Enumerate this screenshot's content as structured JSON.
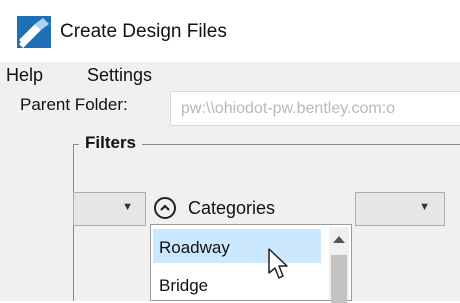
{
  "window": {
    "title": "Create Design Files",
    "icon": "bentley-app-icon"
  },
  "menu": {
    "help": "Help",
    "settings": "Settings"
  },
  "parent_folder": {
    "label": "Parent Folder:",
    "value": "pw:\\\\ohiodot-pw.bentley.com:o"
  },
  "filters": {
    "title": "Filters",
    "categories_label": "Categories",
    "categories_list": [
      "Roadway",
      "Bridge"
    ],
    "selected_index": 0
  },
  "colors": {
    "selection": "#cce8ff",
    "window_bg": "#f0f0f0",
    "app_icon_blue": "#1f6fb4"
  }
}
